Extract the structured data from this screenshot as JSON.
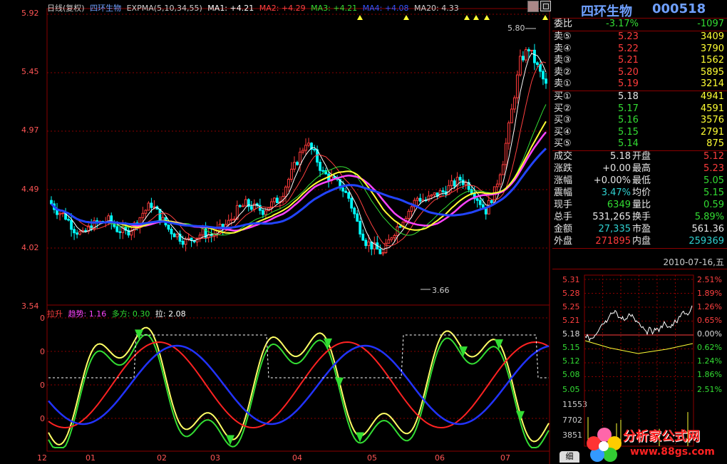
{
  "main_header": {
    "period": "日线(复权)",
    "stock": "四环生物",
    "expma": "EXPMA(5,10,34,55)",
    "ma1": "MA1: +4.21",
    "ma2": "MA2: +4.29",
    "ma3": "MA3: +4.21",
    "ma4": "MA4: +4.08",
    "ma20": "MA20: 4.33"
  },
  "price_axis": [
    "5.92",
    "5.45",
    "4.97",
    "4.49",
    "4.02",
    "3.54"
  ],
  "annotations": {
    "high": "5.80",
    "low": "3.66"
  },
  "indicator_header": {
    "name": "拉升",
    "a": "趋势: 1.16",
    "b": "多方: 0.30",
    "c": "拉: 2.08"
  },
  "indicator_axis": [
    "0",
    "0",
    "0",
    "0"
  ],
  "x_axis": [
    "12",
    "01",
    "02",
    "03",
    "04",
    "05",
    "06",
    "07"
  ],
  "quote": {
    "title_name": "四环生物",
    "title_code": "000518",
    "weibi": {
      "label": "委比",
      "pct": "-3.17%",
      "vol": "-1097"
    },
    "sells": [
      {
        "label": "卖⑤",
        "price": "5.23",
        "vol": "3409"
      },
      {
        "label": "卖④",
        "price": "5.22",
        "vol": "3790"
      },
      {
        "label": "卖③",
        "price": "5.21",
        "vol": "1562"
      },
      {
        "label": "卖②",
        "price": "5.20",
        "vol": "5895"
      },
      {
        "label": "卖①",
        "price": "5.19",
        "vol": "3214"
      }
    ],
    "buys": [
      {
        "label": "买①",
        "price": "5.18",
        "vol": "4941"
      },
      {
        "label": "买②",
        "price": "5.17",
        "vol": "4591"
      },
      {
        "label": "买③",
        "price": "5.16",
        "vol": "3576"
      },
      {
        "label": "买④",
        "price": "5.15",
        "vol": "2791"
      },
      {
        "label": "买⑤",
        "price": "5.14",
        "vol": "875"
      }
    ],
    "stats": [
      {
        "l1": "成交",
        "v1": "5.18",
        "l2": "开盘",
        "v2": "5.12"
      },
      {
        "l1": "涨跌",
        "v1": "+0.00",
        "l2": "最高",
        "v2": "5.23"
      },
      {
        "l1": "涨幅",
        "v1": "+0.00%",
        "l2": "最低",
        "v2": "5.05"
      },
      {
        "l1": "震幅",
        "v1": "3.47%",
        "l2": "均价",
        "v2": "5.15"
      },
      {
        "l1": "现手",
        "v1": "6349",
        "l2": "量比",
        "v2": "0.59"
      },
      {
        "l1": "总手",
        "v1": "531,265",
        "l2": "换手",
        "v2": "5.89%"
      },
      {
        "l1": "金额",
        "v1": "27,335",
        "l2": "市盈",
        "v2": "561.36"
      },
      {
        "l1": "外盘",
        "v1": "271895",
        "l2": "内盘",
        "v2": "259369"
      }
    ],
    "date": "2010-07-16,五",
    "mini_left": [
      "5.31",
      "5.28",
      "5.25",
      "5.21",
      "5.18",
      "5.15",
      "5.12",
      "5.08",
      "5.05",
      "11553",
      "7702",
      "3851"
    ],
    "mini_right": [
      "2.51%",
      "1.89%",
      "1.26%",
      "0.65%",
      "0.00%",
      "0.62%",
      "1.24%",
      "1.86%",
      "2.51%"
    ],
    "tab": "细"
  },
  "logo": {
    "name": "分析家公式网",
    "url": "www.88gs.com"
  },
  "colors": {
    "up": "#ff3b3b",
    "down": "#33dd33",
    "grid": "#8a0000",
    "axis": "#ff3b3b",
    "cyan_candle": "#00ffff"
  }
}
